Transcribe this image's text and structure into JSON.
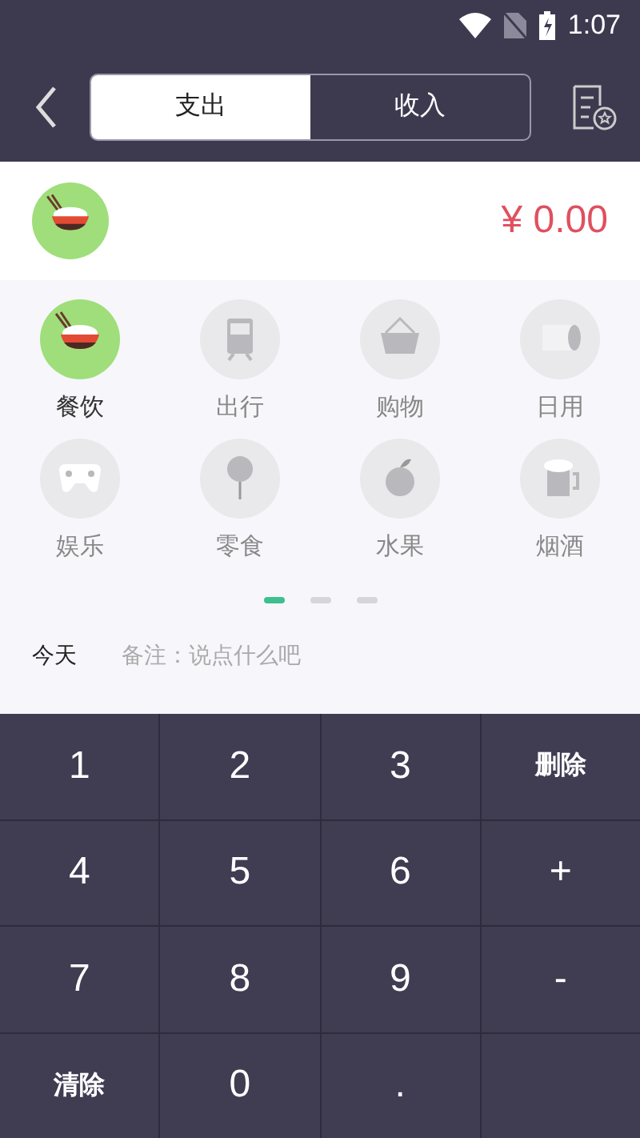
{
  "status_bar": {
    "time": "1:07"
  },
  "tabs": [
    {
      "label": "支出",
      "selected": true
    },
    {
      "label": "收入",
      "selected": false
    }
  ],
  "selected_category": {
    "amount": "¥ 0.00"
  },
  "categories": [
    {
      "label": "餐饮",
      "selected": true,
      "kind": "food"
    },
    {
      "label": "出行",
      "selected": false,
      "kind": "train"
    },
    {
      "label": "购物",
      "selected": false,
      "kind": "basket"
    },
    {
      "label": "日用",
      "selected": false,
      "kind": "roll"
    },
    {
      "label": "娱乐",
      "selected": false,
      "kind": "gamepad"
    },
    {
      "label": "零食",
      "selected": false,
      "kind": "lollipop"
    },
    {
      "label": "水果",
      "selected": false,
      "kind": "apple"
    },
    {
      "label": "烟酒",
      "selected": false,
      "kind": "beer"
    }
  ],
  "pages": [
    {
      "selected": true
    },
    {
      "selected": false
    },
    {
      "selected": false
    }
  ],
  "date": "今天",
  "note": {
    "placeholder": "备注：说点什么吧"
  },
  "keys": [
    {
      "label": "1",
      "kind": "digit"
    },
    {
      "label": "2",
      "kind": "digit"
    },
    {
      "label": "3",
      "kind": "digit"
    },
    {
      "label": "删除",
      "kind": "word"
    },
    {
      "label": "4",
      "kind": "digit"
    },
    {
      "label": "5",
      "kind": "digit"
    },
    {
      "label": "6",
      "kind": "digit"
    },
    {
      "label": "+",
      "kind": "digit"
    },
    {
      "label": "7",
      "kind": "digit"
    },
    {
      "label": "8",
      "kind": "digit"
    },
    {
      "label": "9",
      "kind": "digit"
    },
    {
      "label": "-",
      "kind": "digit"
    },
    {
      "label": "清除",
      "kind": "word"
    },
    {
      "label": "0",
      "kind": "digit"
    },
    {
      "label": ".",
      "kind": "digit"
    },
    {
      "kind": "blank"
    }
  ]
}
